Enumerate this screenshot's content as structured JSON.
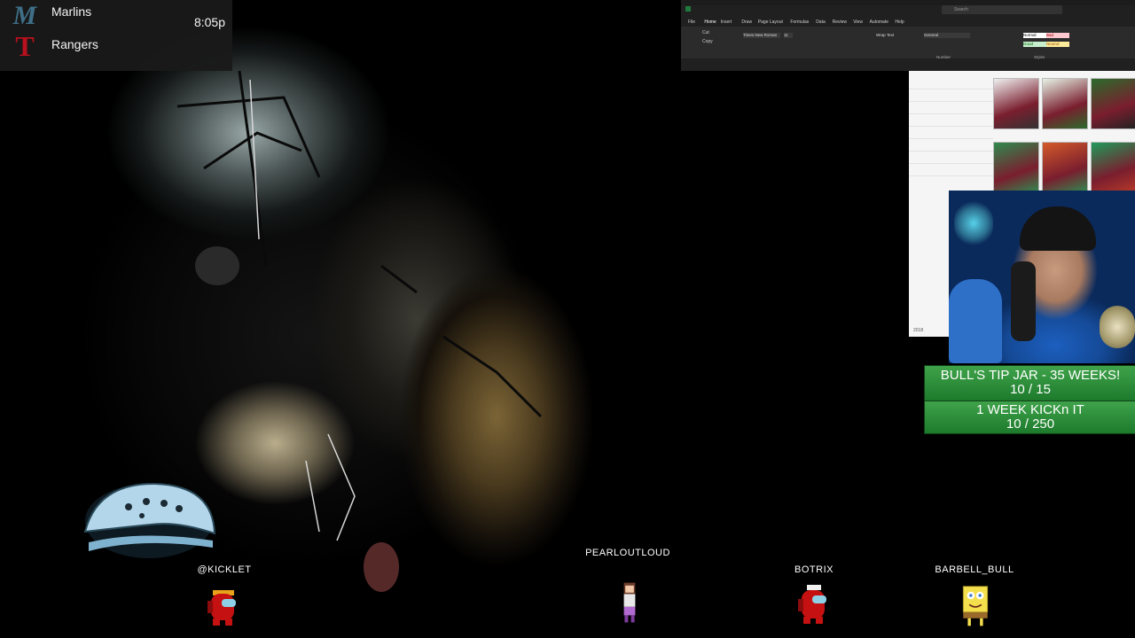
{
  "scorebug": {
    "away_team": "Marlins",
    "home_team": "Rangers",
    "time": "8:05p",
    "away_logo_text": "M",
    "home_logo_text": "T",
    "away_logo_color": "#41748d",
    "home_logo_color": "#c0111f"
  },
  "excel": {
    "menu": [
      "File",
      "Home",
      "Insert",
      "Draw",
      "Page Layout",
      "Formulas",
      "Data",
      "Review",
      "View",
      "Automate",
      "Help"
    ],
    "font_name": "Times New Roman",
    "font_size": "11",
    "number_format": "General",
    "style_normal": "Normal",
    "style_bad": "Bad",
    "style_good": "Good",
    "style_neutral": "Neutral",
    "group_number": "Number",
    "group_styles": "Styles",
    "wrap_text": "Wrap Text",
    "cut": "Cut",
    "copy": "Copy",
    "search": "Search",
    "row_label": "2018"
  },
  "goals": [
    {
      "title": "BULL'S TIP JAR - 35 WEEKS!",
      "progress": "10 / 15"
    },
    {
      "title": "1 WEEK KICKn IT",
      "progress": "10 / 250"
    }
  ],
  "chatters": [
    {
      "name": "@KICKLET"
    },
    {
      "name": "PEARLOUTLOUD"
    },
    {
      "name": "BOTRIX"
    },
    {
      "name": "BARBELL_BULL"
    }
  ],
  "colors": {
    "goal_green": "#3fa34a",
    "crewmate_red": "#c51111",
    "sponge_yellow": "#f4e04d"
  }
}
